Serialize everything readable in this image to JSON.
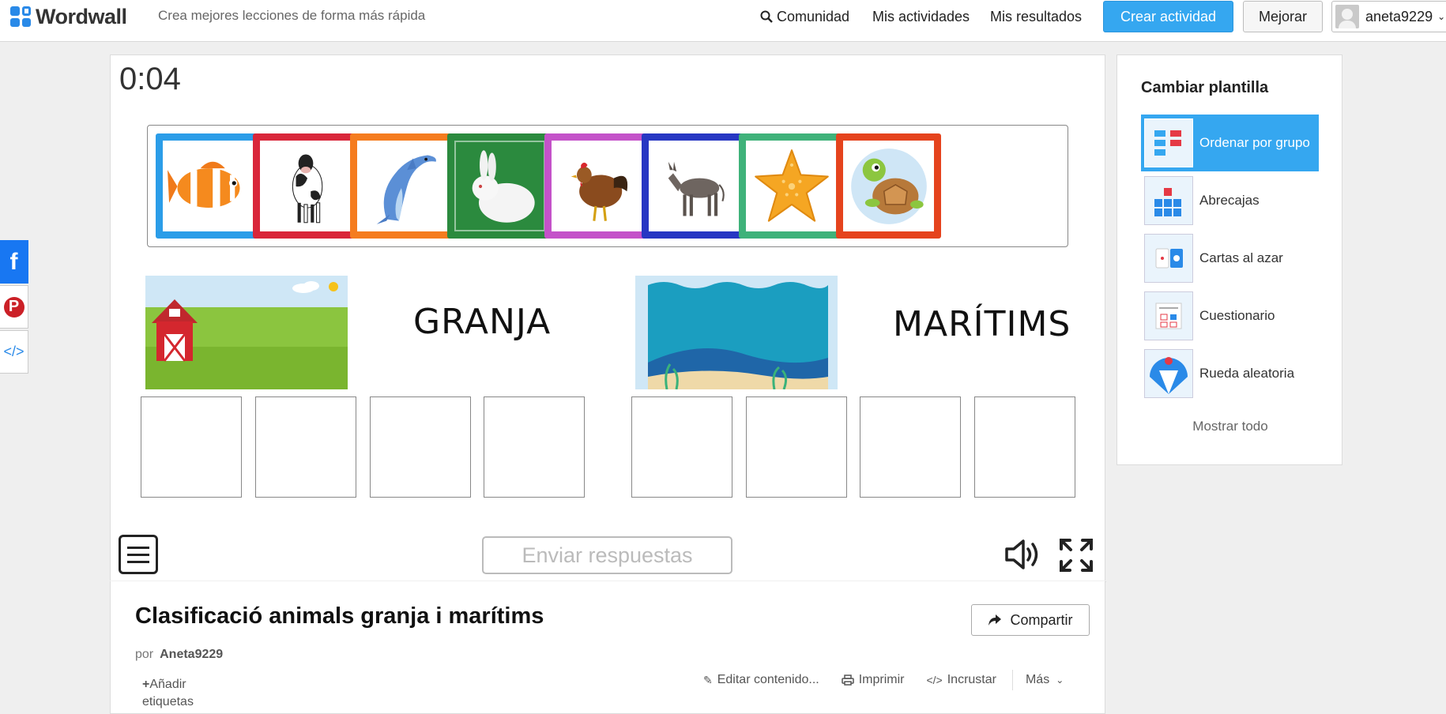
{
  "header": {
    "logo_text": "Wordwall",
    "tagline": "Crea mejores lecciones de forma más rápida",
    "nav": {
      "comunidad": "Comunidad",
      "actividades": "Mis actividades",
      "resultados": "Mis resultados"
    },
    "create_button": "Crear actividad",
    "upgrade_button": "Mejorar",
    "username": "aneta9229",
    "accent_color": "#35a7f0"
  },
  "social": {
    "facebook_icon": "f",
    "pinterest_icon": "P",
    "embed_icon": "</>"
  },
  "game": {
    "timer": "0:04",
    "cards": [
      {
        "animal": "clownfish",
        "border": "#2b9de8"
      },
      {
        "animal": "cow",
        "border": "#d9263a"
      },
      {
        "animal": "dolphin",
        "border": "#f57c1f"
      },
      {
        "animal": "rabbit",
        "border": "#2b8a3e"
      },
      {
        "animal": "hen",
        "border": "#c452c9"
      },
      {
        "animal": "donkey",
        "border": "#2737c3"
      },
      {
        "animal": "starfish",
        "border": "#3fb27a"
      },
      {
        "animal": "turtle",
        "border": "#e5431d"
      }
    ],
    "groups": [
      {
        "label": "GRANJA",
        "image": "farm-image"
      },
      {
        "label": "MARÍTIMS",
        "image": "sea-image"
      }
    ],
    "submit_button": "Enviar respuestas"
  },
  "info": {
    "title": "Clasificació animals granja i marítims",
    "share_button": "Compartir",
    "by_label": "por",
    "author": "Aneta9229",
    "add_tags": "Añadir etiquetas",
    "actions": {
      "edit": "Editar contenido...",
      "print": "Imprimir",
      "embed": "Incrustar",
      "more": "Más"
    }
  },
  "sidebar": {
    "title": "Cambiar plantilla",
    "templates": [
      {
        "label": "Ordenar por grupo",
        "selected": true
      },
      {
        "label": "Abrecajas",
        "selected": false
      },
      {
        "label": "Cartas al azar",
        "selected": false
      },
      {
        "label": "Cuestionario",
        "selected": false
      },
      {
        "label": "Rueda aleatoria",
        "selected": false
      }
    ],
    "show_all": "Mostrar todo"
  }
}
